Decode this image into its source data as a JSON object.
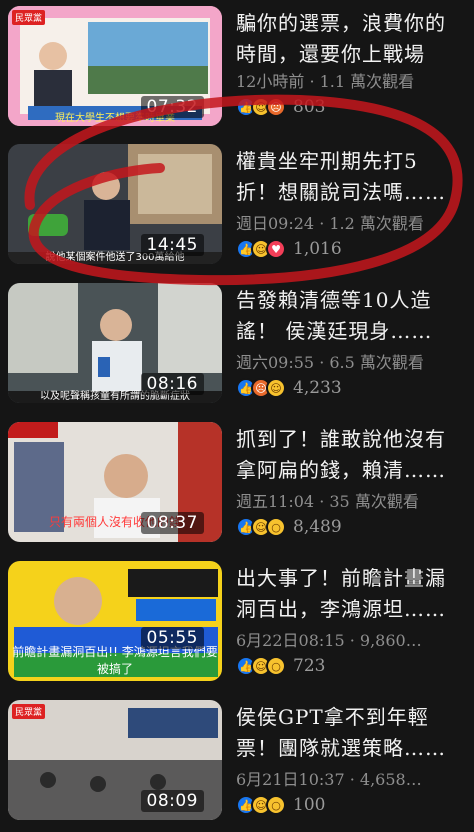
{
  "videos": [
    {
      "title": "騙你的選票，浪費你的\n時間，還要你上戰場",
      "meta": "12小時前 · 1.1 萬次觀看",
      "duration": "07:32",
      "caption": "現在大學生不想要準時畢業",
      "reactions": [
        "like-icon",
        "haha-icon",
        "angry-icon"
      ],
      "count": "803",
      "thumb_colors": [
        "#f3a6c9",
        "#5aa7d8"
      ]
    },
    {
      "title": "權貴坐牢刑期先打5\n折！想關說司法嗎……",
      "meta": "週日09:24 · 1.2 萬次觀看",
      "duration": "14:45",
      "caption": "說他某個案件他送了300萬給他",
      "reactions": [
        "like-icon",
        "haha-icon",
        "love-icon"
      ],
      "count": "1,016",
      "thumb_colors": [
        "#3b3f45",
        "#8c7a62"
      ]
    },
    {
      "title": "告發賴清德等10人造\n謠！  侯漢廷現身……",
      "meta": "週六09:55 · 6.5 萬次觀看",
      "duration": "08:16",
      "caption": "以及呢聲稱孩童有所謂的脆斷症狀",
      "reactions": [
        "like-icon",
        "angry-icon",
        "haha-icon"
      ],
      "count": "4,233",
      "thumb_colors": [
        "#505a5c",
        "#c9cbc7"
      ]
    },
    {
      "title": "抓到了！誰敢說他沒有\n拿阿扁的錢，賴清……",
      "meta": "週五11:04 · 35 萬次觀看",
      "duration": "08:37",
      "caption": "只有兩個人沒有收他的錢",
      "reactions": [
        "like-icon",
        "haha-icon",
        "wow-icon"
      ],
      "count": "8,489",
      "thumb_colors": [
        "#e8e4df",
        "#b63228"
      ]
    },
    {
      "title": "出大事了！前瞻計畫漏\n洞百出，李鴻源坦……",
      "meta": "6月22日08:15 · 9,860…",
      "duration": "05:55",
      "caption": "前瞻計畫漏洞百出!! 李鴻源坦言我們要被搞了",
      "reactions": [
        "like-icon",
        "haha-icon",
        "wow-icon"
      ],
      "count": "723",
      "thumb_colors": [
        "#f5d21b",
        "#1a6ad8"
      ]
    },
    {
      "title": "侯侯GPT拿不到年輕\n票！團隊就選策略……",
      "meta": "6月21日10:37 · 4,658…",
      "duration": "08:09",
      "caption": "",
      "reactions": [
        "like-icon",
        "haha-icon",
        "wow-icon"
      ],
      "count": "100",
      "thumb_colors": [
        "#d8d3cd",
        "#2e4a7a"
      ]
    }
  ],
  "annotation_color": "#c4161c",
  "channel_badge": "民眾黨"
}
